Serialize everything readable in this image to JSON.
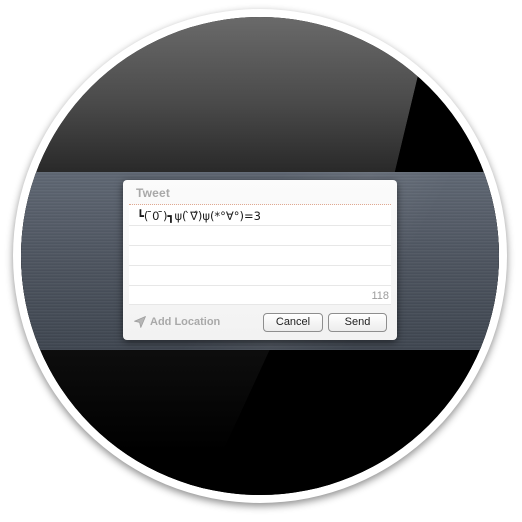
{
  "dialog": {
    "title": "Tweet",
    "tweet_text": "┗( ̄0 ̄)┓ψ( ̀∇́)ψ(*°∀°)=3",
    "char_count": "118",
    "location_label": "Add Location",
    "cancel_label": "Cancel",
    "send_label": "Send"
  },
  "icons": {
    "location": "location-arrow-icon"
  },
  "colors": {
    "title_gray": "#a8a8a8",
    "rule_accent": "#e0a890",
    "strip": "#4d545f"
  }
}
